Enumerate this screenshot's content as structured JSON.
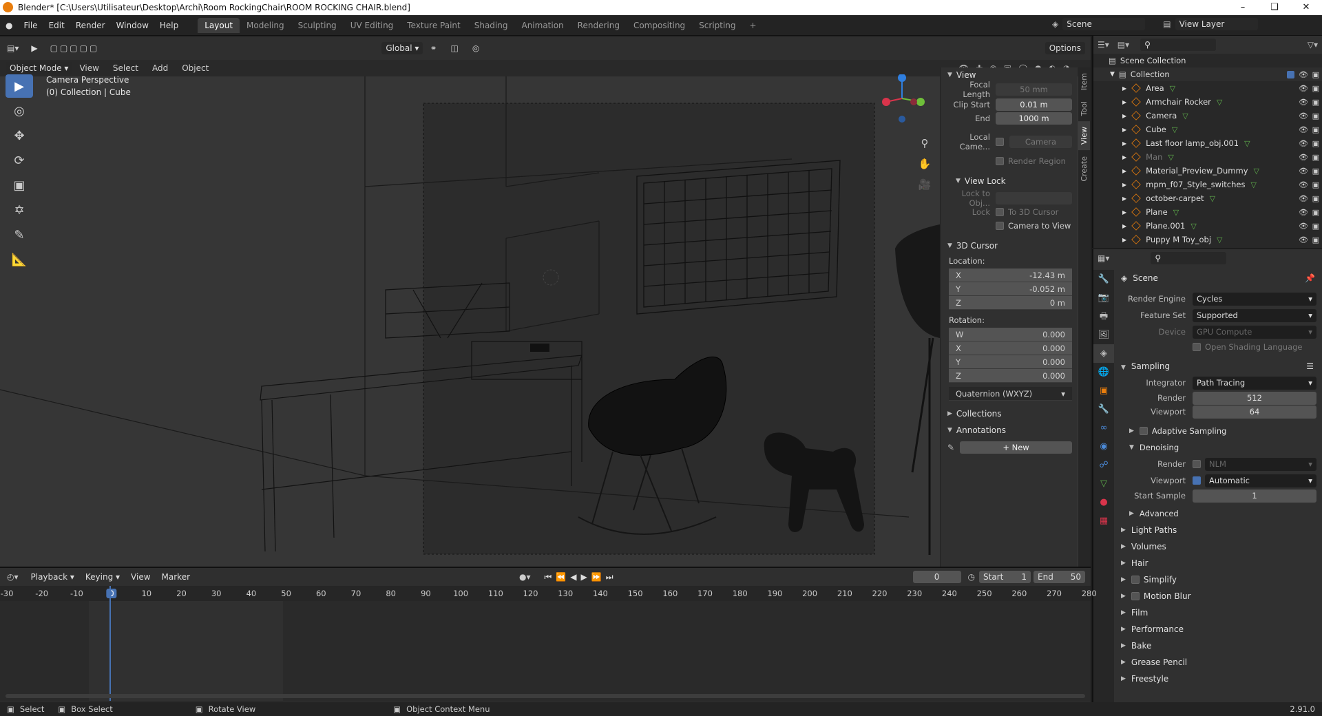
{
  "window": {
    "title": "Blender* [C:\\Users\\Utilisateur\\Desktop\\Archi\\Room RockingChair\\ROOM ROCKING CHAIR.blend]"
  },
  "menus": [
    "File",
    "Edit",
    "Render",
    "Window",
    "Help"
  ],
  "workspaces": [
    "Layout",
    "Modeling",
    "Sculpting",
    "UV Editing",
    "Texture Paint",
    "Shading",
    "Animation",
    "Rendering",
    "Compositing",
    "Scripting"
  ],
  "scene": {
    "name": "Scene",
    "view_layer": "View Layer"
  },
  "viewport": {
    "mode": "Object Mode",
    "menus": [
      "View",
      "Select",
      "Add",
      "Object"
    ],
    "orientation": "Global",
    "options": "Options",
    "overlay_title": "Camera Perspective",
    "overlay_sub": "(0) Collection | Cube"
  },
  "npanel": {
    "view_header": "View",
    "focal_length": {
      "label": "Focal Length",
      "value": "50 mm"
    },
    "clip_start": {
      "label": "Clip Start",
      "value": "0.01 m"
    },
    "clip_end": {
      "label": "End",
      "value": "1000 m"
    },
    "local_camera": {
      "label": "Local Came...",
      "value": "Camera"
    },
    "render_region": "Render Region",
    "view_lock": "View Lock",
    "lock_to_obj": "Lock to Obj...",
    "lock": "Lock",
    "to_3d_cursor": "To 3D Cursor",
    "camera_to_view": "Camera to View",
    "cursor_header": "3D Cursor",
    "location": "Location:",
    "loc": [
      {
        "k": "X",
        "v": "-12.43 m"
      },
      {
        "k": "Y",
        "v": "-0.052 m"
      },
      {
        "k": "Z",
        "v": "0 m"
      }
    ],
    "rotation": "Rotation:",
    "rot": [
      {
        "k": "W",
        "v": "0.000"
      },
      {
        "k": "X",
        "v": "0.000"
      },
      {
        "k": "Y",
        "v": "0.000"
      },
      {
        "k": "Z",
        "v": "0.000"
      }
    ],
    "rot_mode": "Quaternion (WXYZ)",
    "collections": "Collections",
    "annotations": "Annotations",
    "new": "New",
    "tabs": [
      "Item",
      "Tool",
      "View",
      "Create"
    ]
  },
  "outliner": {
    "root": "Scene Collection",
    "collection": "Collection",
    "items": [
      "Area",
      "Armchair Rocker",
      "Camera",
      "Cube",
      "Last floor lamp_obj.001",
      "Man",
      "Material_Preview_Dummy",
      "mpm_f07_Style_switches",
      "october-carpet",
      "Plane",
      "Plane.001",
      "Puppy M Toy_obj"
    ]
  },
  "props": {
    "title": "Scene",
    "render_engine": {
      "label": "Render Engine",
      "value": "Cycles"
    },
    "feature_set": {
      "label": "Feature Set",
      "value": "Supported"
    },
    "device": {
      "label": "Device",
      "value": "GPU Compute"
    },
    "osl": "Open Shading Language",
    "sampling": "Sampling",
    "integrator": {
      "label": "Integrator",
      "value": "Path Tracing"
    },
    "render": {
      "label": "Render",
      "value": "512"
    },
    "viewport": {
      "label": "Viewport",
      "value": "64"
    },
    "adaptive": "Adaptive Sampling",
    "denoising": "Denoising",
    "dn_render": {
      "label": "Render",
      "value": "NLM"
    },
    "dn_viewport": {
      "label": "Viewport",
      "value": "Automatic"
    },
    "start_sample": {
      "label": "Start Sample",
      "value": "1"
    },
    "advanced": "Advanced",
    "sections": [
      "Light Paths",
      "Volumes",
      "Hair",
      "Simplify",
      "Motion Blur",
      "Film",
      "Performance",
      "Bake",
      "Grease Pencil",
      "Freestyle"
    ]
  },
  "timeline": {
    "menus": [
      "Playback",
      "Keying",
      "View",
      "Marker"
    ],
    "current": "0",
    "start_label": "Start",
    "start": "1",
    "end_label": "End",
    "end": "50",
    "ticks": [
      "-30",
      "-20",
      "-10",
      "0",
      "10",
      "20",
      "30",
      "40",
      "50",
      "60",
      "70",
      "80",
      "90",
      "100",
      "110",
      "120",
      "130",
      "140",
      "150",
      "160",
      "170",
      "180",
      "190",
      "200",
      "210",
      "220",
      "230",
      "240",
      "250",
      "260",
      "270",
      "280"
    ]
  },
  "status": {
    "select": "Select",
    "box": "Box Select",
    "rotate": "Rotate View",
    "ctx": "Object Context Menu",
    "version": "2.91.0"
  }
}
